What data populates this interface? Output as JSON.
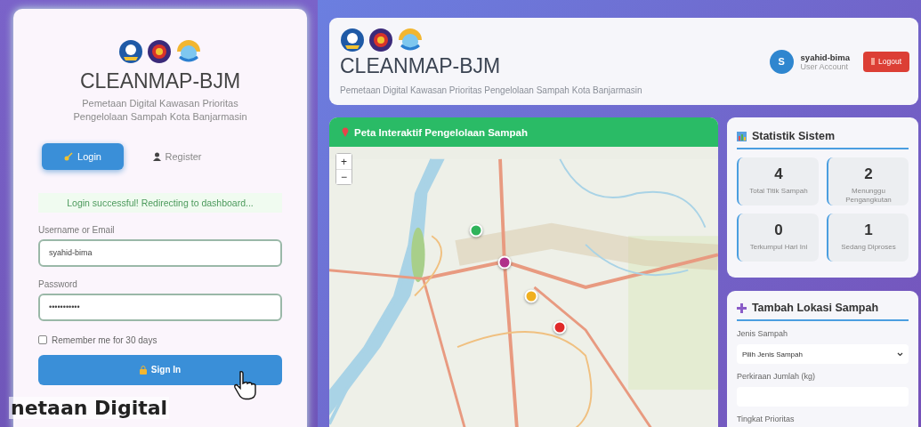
{
  "login_screen": {
    "title": "CLEANMAP-BJM",
    "subtitle": "Pemetaan Digital Kawasan Prioritas Pengelolaan Sampah Kota Banjarmasin",
    "tabs": [
      {
        "label": "Login",
        "selected": true
      },
      {
        "label": "Register",
        "selected": false
      }
    ],
    "alert": "Login successful! Redirecting to dashboard...",
    "fields": [
      {
        "label": "Username or Email",
        "value": "syahid-bima"
      },
      {
        "label": "Password",
        "value": "•••••••••••"
      }
    ],
    "remember": {
      "label": "Remember me for 30 days",
      "checked": false
    },
    "submit": "Sign In",
    "caption": "netaan Digital"
  },
  "dashboard": {
    "header": {
      "title": "CLEANMAP-BJM",
      "subtitle": "Pemetaan Digital Kawasan Prioritas Pengelolaan Sampah Kota Banjarmasin",
      "user": {
        "initial": "S",
        "name": "syahid-bima",
        "role": "User Account"
      },
      "logout": "Logout"
    },
    "map": {
      "title": "Peta Interaktif Pengelolaan Sampah",
      "zoom_in": "+",
      "zoom_out": "−",
      "markers": [
        {
          "color": "#2fb35a"
        },
        {
          "color": "#b0308a"
        },
        {
          "color": "#f0b020"
        },
        {
          "color": "#e02a2a"
        }
      ]
    },
    "stats": {
      "title": "Statistik Sistem",
      "items": [
        {
          "value": "4",
          "label": "Total Titik Sampah"
        },
        {
          "value": "2",
          "label": "Menunggu Pengangkutan"
        },
        {
          "value": "0",
          "label": "Terkumpul Hari Ini"
        },
        {
          "value": "1",
          "label": "Sedang Diproses"
        }
      ]
    },
    "add_form": {
      "title": "Tambah Lokasi Sampah",
      "fields": [
        {
          "kind": "select",
          "label": "Jenis Sampah",
          "value": "Pilih Jenis Sampah"
        },
        {
          "kind": "text",
          "label": "Perkiraan Jumlah (kg)"
        },
        {
          "kind": "heading",
          "label": "Tingkat Prioritas"
        }
      ]
    }
  }
}
